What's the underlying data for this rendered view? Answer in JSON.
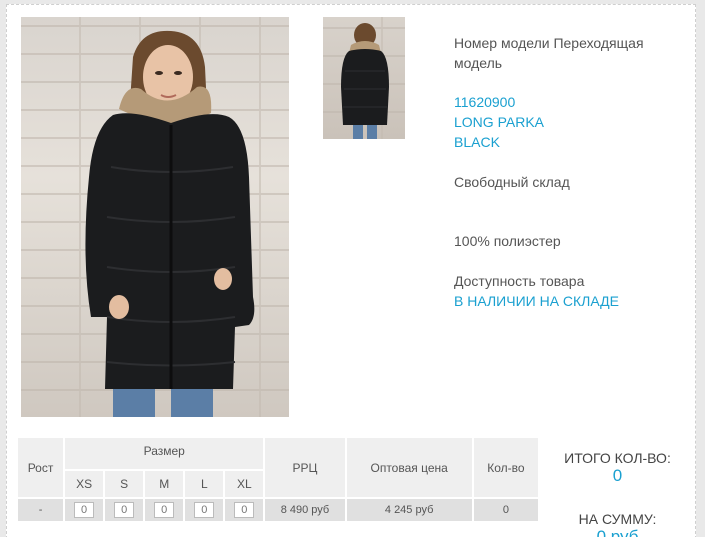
{
  "product": {
    "model_label": "Номер модели Переходящая модель",
    "article": "11620900",
    "name": "LONG PARKA",
    "color": "BLACK",
    "warehouse": "Свободный склад",
    "material": "100% полиэстер",
    "availability_label": "Доступность товара",
    "availability_value": "В НАЛИЧИИ НА СКЛАДЕ"
  },
  "table": {
    "headers": {
      "height": "Рост",
      "size": "Размер",
      "rrp": "РРЦ",
      "wholesale": "Оптовая цена",
      "qty": "Кол-во"
    },
    "sizes": [
      "XS",
      "S",
      "M",
      "L",
      "XL"
    ],
    "row": {
      "height": "-",
      "quantities": [
        "0",
        "0",
        "0",
        "0",
        "0"
      ],
      "rrp": "8 490 руб",
      "wholesale": "4 245 руб",
      "qty": "0"
    }
  },
  "totals": {
    "count_label": "ИТОГО КОЛ-ВО:",
    "count_value": "0",
    "sum_label": "НА СУММУ:",
    "sum_value": "0 руб"
  },
  "colors": {
    "accent": "#1aa0d0",
    "coat": "#1b1c1e",
    "jeans": "#5b7ea6"
  },
  "icons": {
    "main_photo": "product-photo-front",
    "thumbnail": "product-photo-back"
  }
}
